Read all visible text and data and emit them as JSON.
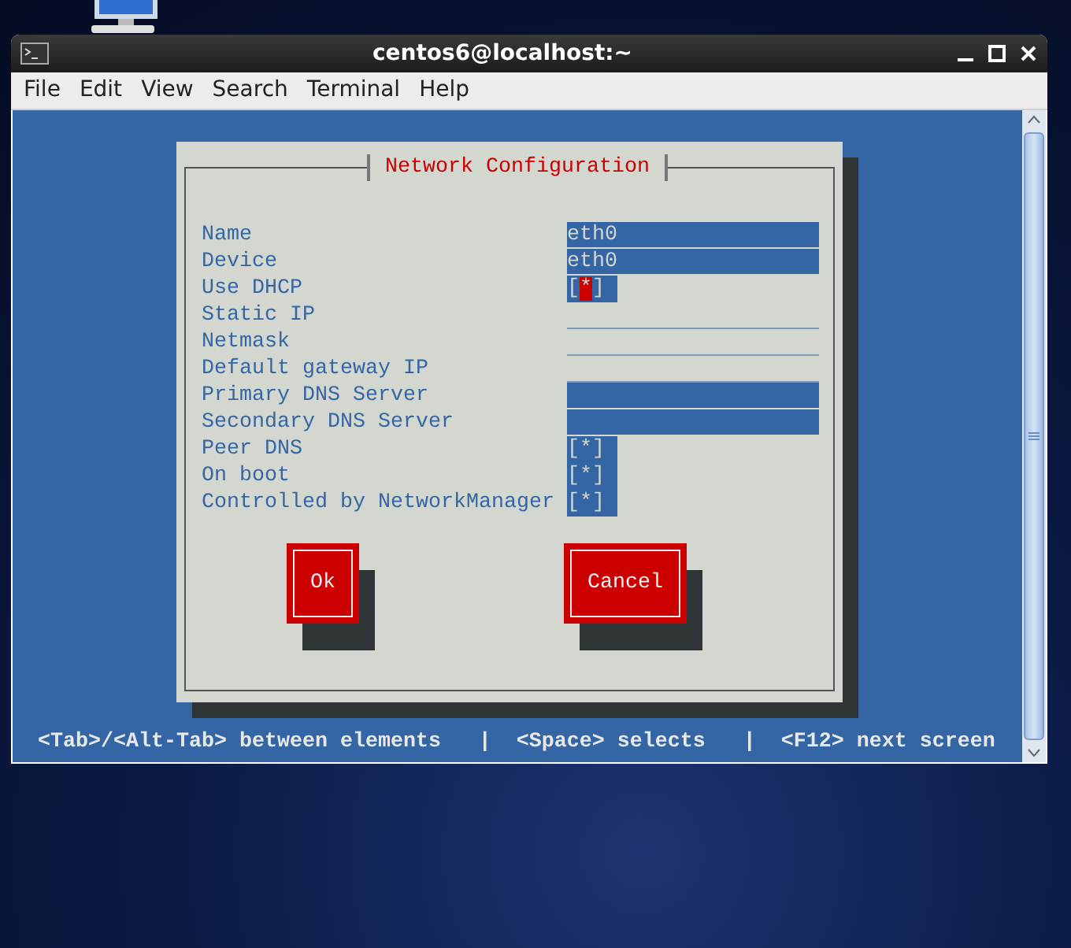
{
  "window": {
    "title": "centos6@localhost:~"
  },
  "menu": [
    "File",
    "Edit",
    "View",
    "Search",
    "Terminal",
    "Help"
  ],
  "dialog": {
    "title": "Network Configuration",
    "fields": [
      {
        "label": "Name",
        "kind": "text",
        "value": "eth0",
        "disabled": false
      },
      {
        "label": "Device",
        "kind": "text",
        "value": "eth0",
        "disabled": false
      },
      {
        "label": "Use DHCP",
        "kind": "checkbox",
        "value": "[*]",
        "focused": true
      },
      {
        "label": "Static IP",
        "kind": "text",
        "disabled": true
      },
      {
        "label": "Netmask",
        "kind": "text",
        "disabled": true
      },
      {
        "label": "Default gateway IP",
        "kind": "text",
        "disabled": true
      },
      {
        "label": "Primary DNS Server",
        "kind": "text",
        "disabled": false
      },
      {
        "label": "Secondary DNS Server",
        "kind": "text",
        "disabled": false
      },
      {
        "label": "Peer DNS",
        "kind": "checkbox",
        "value": "[*]",
        "focused": false
      },
      {
        "label": "On boot",
        "kind": "checkbox",
        "value": "[*]",
        "focused": false
      },
      {
        "label": "Controlled by NetworkManager",
        "kind": "checkbox",
        "value": "[*]",
        "focused": false
      }
    ],
    "buttons": [
      {
        "label": "Ok"
      },
      {
        "label": "Cancel"
      }
    ]
  },
  "status_bar": "<Tab>/<Alt-Tab> between elements   |  <Space> selects   |  <F12> next screen"
}
